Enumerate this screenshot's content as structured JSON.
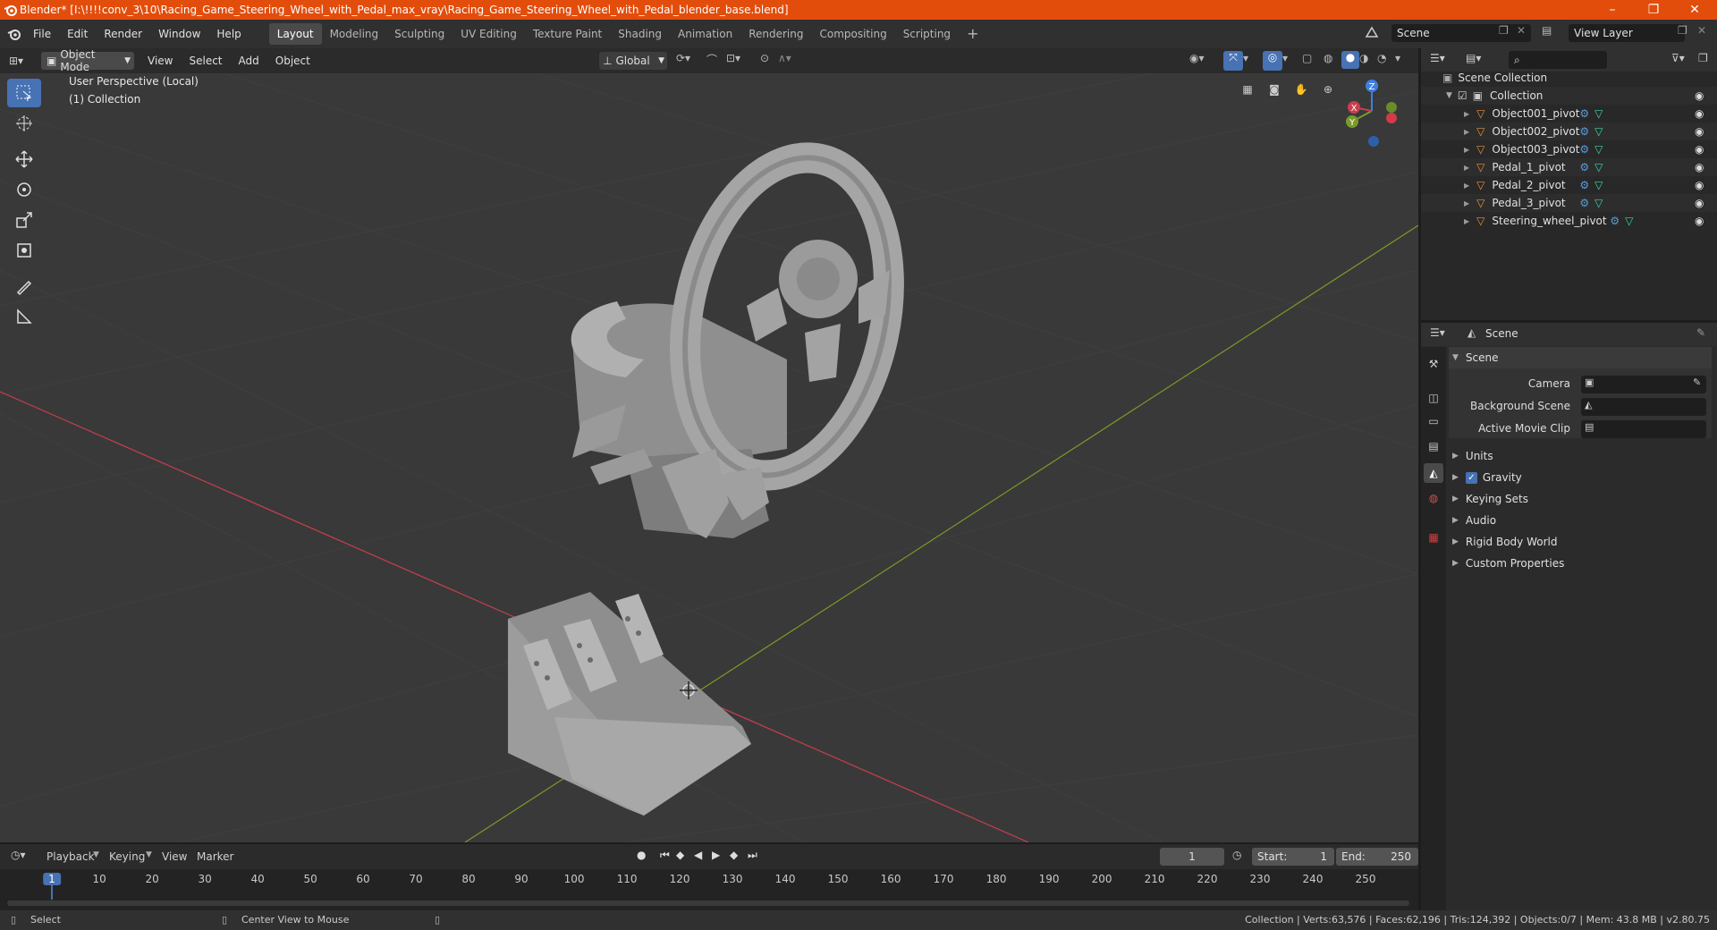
{
  "window": {
    "title": "Blender* [I:\\!!!!conv_3\\10\\Racing_Game_Steering_Wheel_with_Pedal_max_vray\\Racing_Game_Steering_Wheel_with_Pedal_blender_base.blend]",
    "minimize": "–",
    "maximize": "❐",
    "close": "✕"
  },
  "menu": [
    "File",
    "Edit",
    "Render",
    "Window",
    "Help"
  ],
  "workspaces": [
    "Layout",
    "Modeling",
    "Sculpting",
    "UV Editing",
    "Texture Paint",
    "Shading",
    "Animation",
    "Rendering",
    "Compositing",
    "Scripting"
  ],
  "active_workspace": "Layout",
  "scene_field": "Scene",
  "view_layer_field": "View Layer",
  "viewport_header": {
    "mode": "Object Mode",
    "menus": [
      "View",
      "Select",
      "Add",
      "Object"
    ],
    "orientation": "Global"
  },
  "viewport": {
    "perspective": "User Perspective (Local)",
    "collection": "(1) Collection",
    "gizmo_axes": {
      "x": "X",
      "y": "Y",
      "z": "Z"
    }
  },
  "outliner": {
    "root": "Scene Collection",
    "collection": "Collection",
    "items": [
      "Object001_pivot",
      "Object002_pivot",
      "Object003_pivot",
      "Pedal_1_pivot",
      "Pedal_2_pivot",
      "Pedal_3_pivot",
      "Steering_wheel_pivot"
    ]
  },
  "properties": {
    "context": "Scene",
    "panel_title": "Scene",
    "fields": [
      {
        "label": "Camera",
        "value": ""
      },
      {
        "label": "Background Scene",
        "value": ""
      },
      {
        "label": "Active Movie Clip",
        "value": ""
      }
    ],
    "sections": [
      "Units",
      "Gravity",
      "Keying Sets",
      "Audio",
      "Rigid Body World",
      "Custom Properties"
    ],
    "gravity_checked": true
  },
  "timeline": {
    "menus": [
      "Playback",
      "Keying",
      "View",
      "Marker"
    ],
    "current_frame": "1",
    "start_label": "Start:",
    "start": "1",
    "end_label": "End:",
    "end": "250",
    "ticks": [
      "1",
      "10",
      "20",
      "30",
      "40",
      "50",
      "60",
      "70",
      "80",
      "90",
      "100",
      "110",
      "120",
      "130",
      "140",
      "150",
      "160",
      "170",
      "180",
      "190",
      "200",
      "210",
      "220",
      "230",
      "240",
      "250"
    ]
  },
  "status": {
    "left_action": "Select",
    "mid_action": "Center View to Mouse",
    "stats": "Collection | Verts:63,576 | Faces:62,196 | Tris:124,392 | Objects:0/7 | Mem: 43.8 MB | v2.80.75"
  },
  "colors": {
    "title_bar": "#e34d0c",
    "accent": "#4772b3",
    "x_axis": "#c93f4c",
    "y_axis": "#7a9a2b",
    "z_axis": "#3f7fe0"
  }
}
